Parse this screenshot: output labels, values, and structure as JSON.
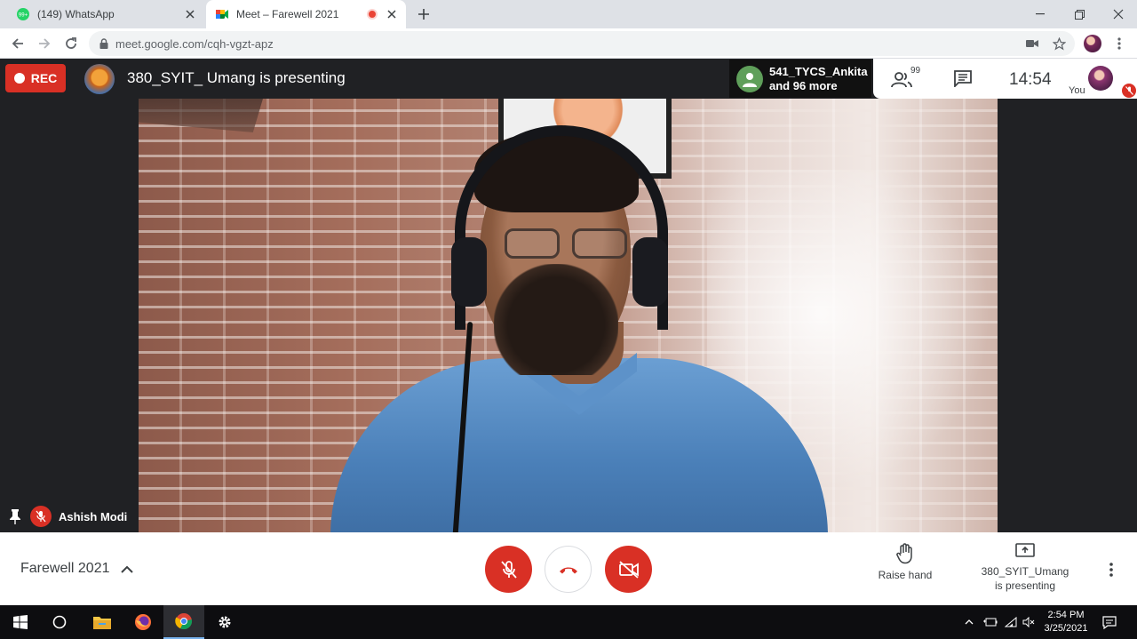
{
  "browser": {
    "tabs": [
      {
        "title": "(149) WhatsApp",
        "badge": "99+",
        "active": false
      },
      {
        "title": "Meet – Farewell 2021",
        "active": true,
        "recording": true
      }
    ],
    "url": "meet.google.com/cqh-vgzt-apz"
  },
  "meet": {
    "rec_label": "REC",
    "presenting_title": "380_SYIT_ Umang is presenting",
    "participant_chip": {
      "line1": "541_TYCS_Ankita",
      "line2": "and 96 more"
    },
    "people_count": "99",
    "clock": "14:54",
    "you_label": "You",
    "tile_name": "Ashish Modi",
    "meeting_name": "Farewell 2021",
    "raise_hand_label": "Raise hand",
    "presenting_line1": "380_SYIT_Umang",
    "presenting_line2": "is presenting"
  },
  "taskbar": {
    "time": "2:54 PM",
    "date": "3/25/2021"
  },
  "colors": {
    "accent_red": "#d93025",
    "meet_dark": "#202124"
  }
}
